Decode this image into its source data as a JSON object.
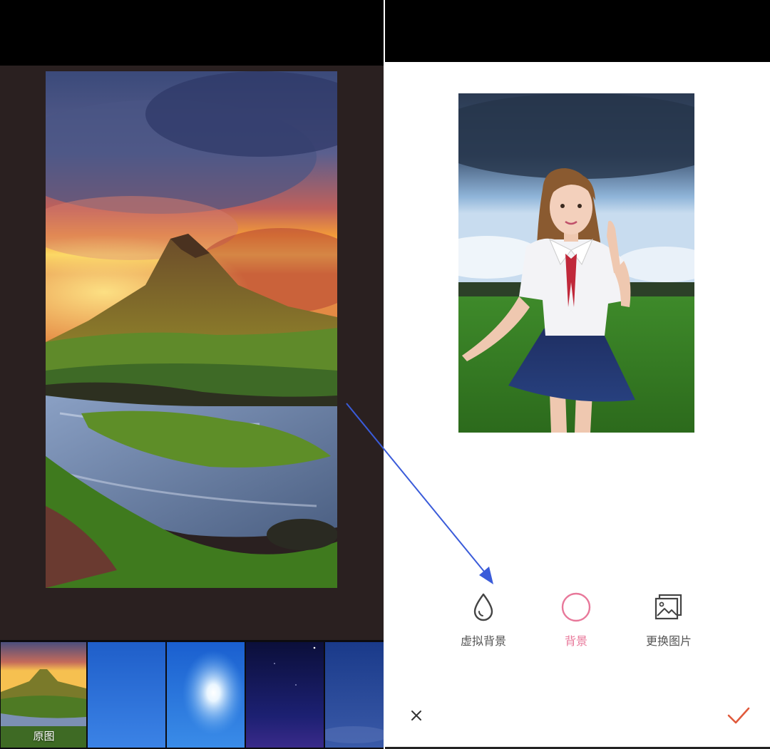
{
  "left_panel": {
    "thumbnails": [
      {
        "name": "original",
        "label": "原图"
      },
      {
        "name": "blue-gradient"
      },
      {
        "name": "sunburst"
      },
      {
        "name": "night-sky"
      },
      {
        "name": "dark-blue"
      }
    ]
  },
  "right_panel": {
    "tools": [
      {
        "label": "虚拟背景",
        "icon": "drop-icon"
      },
      {
        "label": "背景",
        "icon": "circle-icon",
        "active": true
      },
      {
        "label": "更换图片",
        "icon": "gallery-icon"
      }
    ],
    "cancel_icon": "close-icon",
    "confirm_icon": "check-icon"
  },
  "colors": {
    "accent_pink": "#e8789a",
    "confirm_red": "#e05a3c",
    "arrow_blue": "#3a5bd9"
  }
}
